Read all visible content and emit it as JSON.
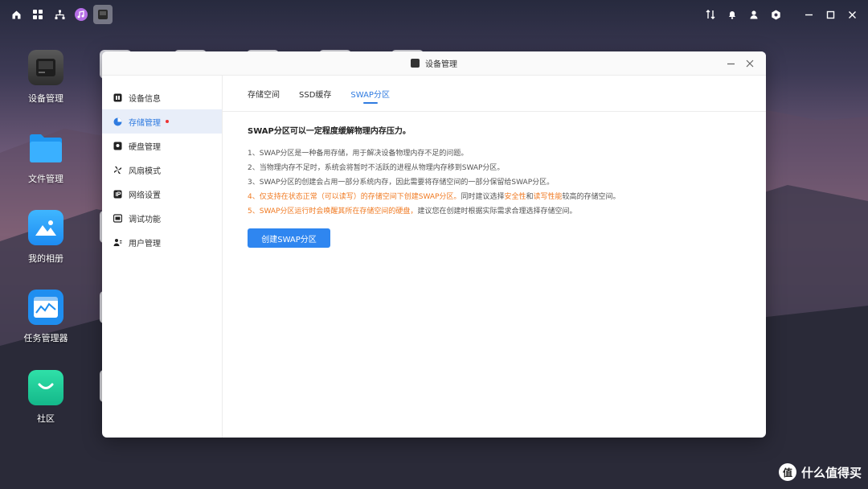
{
  "topbar": {
    "left_icons": [
      "home-icon",
      "apps-grid-icon",
      "network-icon",
      "music-icon",
      "device-manager-icon"
    ],
    "right_icons": [
      "sort-icon",
      "bell-icon",
      "user-icon",
      "settings-icon",
      "minimize-icon",
      "maximize-icon",
      "close-icon"
    ]
  },
  "desktop": {
    "icons": [
      {
        "label": "设备管理",
        "icon": "nas-device-icon"
      },
      {
        "label": "文件管理",
        "icon": "folder-icon"
      },
      {
        "label": "我的相册",
        "icon": "photo-icon"
      },
      {
        "label": "任务管理器",
        "icon": "chart-monitor-icon"
      },
      {
        "label": "社区",
        "icon": "community-chat-icon"
      }
    ]
  },
  "window": {
    "title": "设备管理",
    "sidebar": [
      {
        "label": "设备信息",
        "icon": "info-icon"
      },
      {
        "label": "存储管理",
        "icon": "pie-icon",
        "active": true,
        "badge": true
      },
      {
        "label": "硬盘管理",
        "icon": "disk-icon"
      },
      {
        "label": "风扇模式",
        "icon": "fan-icon"
      },
      {
        "label": "网络设置",
        "icon": "ip-icon"
      },
      {
        "label": "调试功能",
        "icon": "terminal-icon"
      },
      {
        "label": "用户管理",
        "icon": "users-icon"
      }
    ],
    "tabs": [
      {
        "label": "存储空间"
      },
      {
        "label": "SSD缓存"
      },
      {
        "label": "SWAP分区",
        "active": true
      }
    ],
    "headline": "SWAP分区可以一定程度缓解物理内存压力。",
    "lines": {
      "l1": "1、SWAP分区是一种备用存储，用于解决设备物理内存不足的问题。",
      "l2": "2、当物理内存不足时，系统会将暂时不活跃的进程从物理内存移到SWAP分区。",
      "l3": "3、SWAP分区的创建会占用一部分系统内存，因此需要将存储空间的一部分保留给SWAP分区。",
      "l4_warn": "4、仅支持在状态正常（可以读写）的存储空间下创建SWAP分区。",
      "l4_mid": "同时建议选择",
      "l4_warn2": "安全性",
      "l4_and": "和",
      "l4_warn3": "读写性能",
      "l4_end": "较高的存储空间。",
      "l5_warn": "5、SWAP分区运行时会唤醒其所在存储空间的硬盘，",
      "l5_end": "建议您在创建时根据实际需求合理选择存储空间。"
    },
    "button": "创建SWAP分区"
  },
  "watermark": {
    "badge": "值",
    "text": "什么值得买"
  },
  "colors": {
    "accent": "#2f86f0",
    "warning": "#f07a22"
  }
}
